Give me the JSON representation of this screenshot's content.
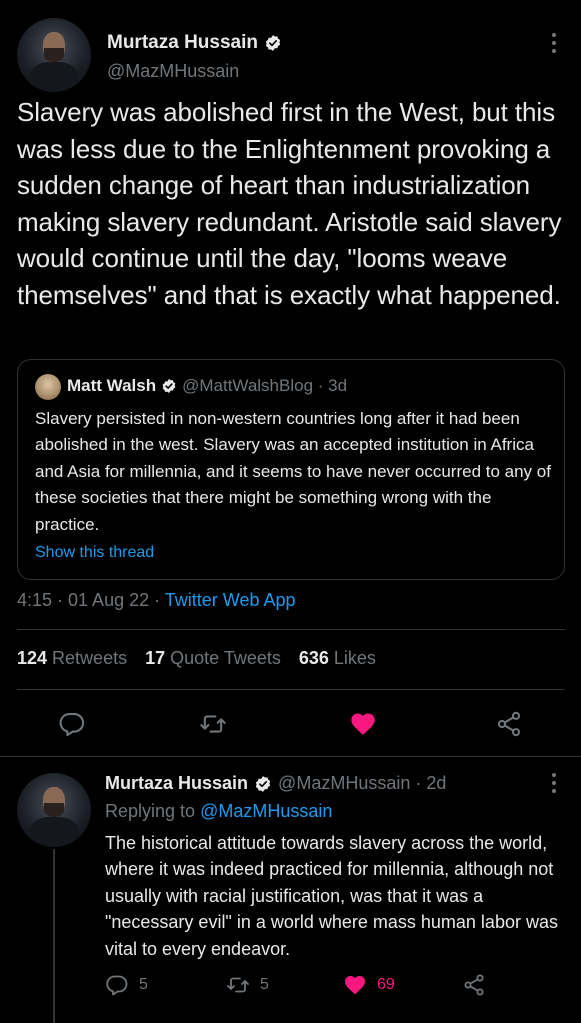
{
  "main": {
    "author_name": "Murtaza Hussain",
    "author_handle": "@MazMHussain",
    "text": "Slavery was abolished first in the West, but this was less due to the Enlightenment provoking a sudden change of heart than industrialization making slavery redundant. Aristotle said slavery would continue until the day, \"looms weave themselves\" and that is exactly what happened.",
    "time": "4:15 · 01 Aug 22 · ",
    "source": "Twitter Web App",
    "retweets": "124",
    "retweets_label": "Retweets",
    "quotes": "17",
    "quotes_label": "Quote Tweets",
    "likes": "636",
    "likes_label": "Likes"
  },
  "quote": {
    "author_name": "Matt Walsh",
    "author_handle": "@MattWalshBlog · 3d",
    "text": "Slavery persisted in non-western countries long after it had been abolished in the west. Slavery was an accepted institution in Africa and Asia for millennia, and it seems to have never occurred to any of these societies that there might be something wrong with the practice.",
    "show_thread": "Show this thread"
  },
  "reply": {
    "author_name": "Murtaza Hussain",
    "author_handle": "@MazMHussain · 2d",
    "replying_to_label": "Replying to ",
    "replying_to": "@MazMHussain",
    "text": "The historical attitude towards slavery across the world, where it was indeed practiced for millennia, although not usually with racial justification, was that it was a \"necessary evil\" in a world where mass human labor was vital to every endeavor.",
    "reply_count": "5",
    "retweet_count": "5",
    "like_count": "69"
  },
  "icons": {
    "verified": "verified-badge-icon",
    "reply": "reply-icon",
    "retweet": "retweet-icon",
    "like": "heart-icon",
    "share": "share-icon",
    "more": "more-icon"
  },
  "colors": {
    "background": "#000000",
    "text": "#e7e9ea",
    "muted": "#71767b",
    "accent": "#1d9bf0",
    "like": "#f91880"
  }
}
